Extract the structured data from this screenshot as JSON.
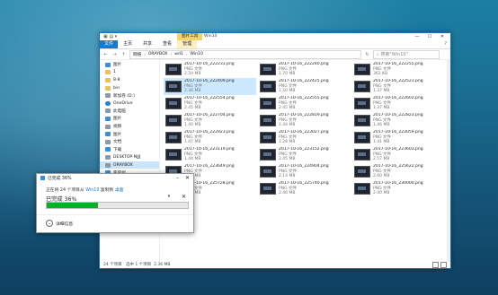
{
  "window": {
    "title": "Win10",
    "context_tab": "图片工具",
    "ribbon": {
      "file": "文件",
      "tabs": [
        "主页",
        "共享",
        "查看",
        "管理"
      ],
      "help": "?"
    },
    "controls": {
      "minimize": "—",
      "maximize": "☐",
      "close": "✕"
    }
  },
  "address": {
    "crumbs": [
      "网络",
      "ORAYBOX",
      "wd1",
      "Win10"
    ],
    "search_placeholder": "搜索\"Win10\""
  },
  "sidebar": {
    "items": [
      {
        "label": "图片",
        "icon": "pictures-icon",
        "pin": true
      },
      {
        "label": "1",
        "icon": "folder-icon"
      },
      {
        "label": "8-8",
        "icon": "folder-icon"
      },
      {
        "label": "bin",
        "icon": "folder-icon"
      },
      {
        "label": "新加卷 (D:)",
        "icon": "drive-icon"
      },
      {
        "label": "OneDrive",
        "icon": "onedrive-icon"
      },
      {
        "label": "此电脑",
        "icon": "pc-icon"
      },
      {
        "label": "图片",
        "icon": "pictures-icon"
      },
      {
        "label": "视频",
        "icon": "videos-icon"
      },
      {
        "label": "图片",
        "icon": "pictures-icon"
      },
      {
        "label": "文档",
        "icon": "documents-icon"
      },
      {
        "label": "下载",
        "icon": "downloads-icon"
      },
      {
        "label": "DESKTOP-NJJJ",
        "icon": "computer-icon"
      },
      {
        "label": "ORAYBOX",
        "icon": "computer-icon",
        "selected": true
      },
      {
        "label": "家庭组",
        "icon": "homegroup-icon"
      }
    ]
  },
  "files": [
    {
      "name": "2017-10-16_222233.png",
      "type": "PNG 文件",
      "size": "2.59 MB"
    },
    {
      "name": "2017-10-16_222240.png",
      "type": "PNG 文件",
      "size": "1.70 MB"
    },
    {
      "name": "2017-10-16_222255.png",
      "type": "PNG 文件",
      "size": "362 KB"
    },
    {
      "name": "2017-10-16_222409.png",
      "type": "PNG 文件",
      "size": "2.36 MB",
      "selected": true
    },
    {
      "name": "2017-10-16_222425.png",
      "type": "PNG 文件",
      "size": "1.50 MB"
    },
    {
      "name": "2017-10-16_222523.png",
      "type": "PNG 文件",
      "size": "1.37 MB"
    },
    {
      "name": "2017-10-16_222554.png",
      "type": "PNG 文件",
      "size": "2.45 MB"
    },
    {
      "name": "2017-10-16_222555.png",
      "type": "PNG 文件",
      "size": "2.45 MB"
    },
    {
      "name": "2017-10-16_222602.png",
      "type": "PNG 文件",
      "size": "1.37 MB"
    },
    {
      "name": "2017-10-16_222704.png",
      "type": "PNG 文件",
      "size": "1.40 MB"
    },
    {
      "name": "2017-10-16_222819.png",
      "type": "PNG 文件",
      "size": "1.44 MB"
    },
    {
      "name": "2017-10-16_222823.png",
      "type": "PNG 文件",
      "size": "1.46 MB"
    },
    {
      "name": "2017-10-16_222923.png",
      "type": "PNG 文件",
      "size": "1.47 MB"
    },
    {
      "name": "2017-10-16_223027.png",
      "type": "PNG 文件",
      "size": "1.28 MB"
    },
    {
      "name": "2017-10-16_223059.png",
      "type": "PNG 文件",
      "size": "1.41 MB"
    },
    {
      "name": "2017-10-16_223119.png",
      "type": "PNG 文件",
      "size": "1.44 MB"
    },
    {
      "name": "2017-10-16_223152.png",
      "type": "PNG 文件",
      "size": "2.45 MB"
    },
    {
      "name": "2017-10-16_223603.png",
      "type": "PNG 文件",
      "size": "2.57 MB"
    },
    {
      "name": "2017-10-16_223649.png",
      "type": "PNG 文件",
      "size": "2.06 MB"
    },
    {
      "name": "2017-10-16_224904.png",
      "type": "PNG 文件",
      "size": "2.14 MB"
    },
    {
      "name": "2017-10-16_225622.png",
      "type": "PNG 文件",
      "size": "2.60 MB"
    },
    {
      "name": "2017-10-16_225728.png",
      "type": "PNG 文件",
      "size": "2.40 MB"
    },
    {
      "name": "2017-10-16_225740.png",
      "type": "PNG 文件",
      "size": "2.40 MB"
    },
    {
      "name": "2017-10-16_230000.png",
      "type": "PNG 文件",
      "size": "2.40 MB"
    }
  ],
  "status": {
    "count": "24 个项目",
    "selected": "选中 1 个项目",
    "size": "2.36 MB"
  },
  "copy_dialog": {
    "title": "已完成 36%",
    "line_prefix": "正在将 24 个项目从",
    "source": "Win10",
    "line_mid": "复制到",
    "dest": "桌面",
    "percent_text": "已完成 36%",
    "progress": 0.36,
    "pause": "⏸",
    "stop": "✕",
    "more": "详细信息"
  }
}
